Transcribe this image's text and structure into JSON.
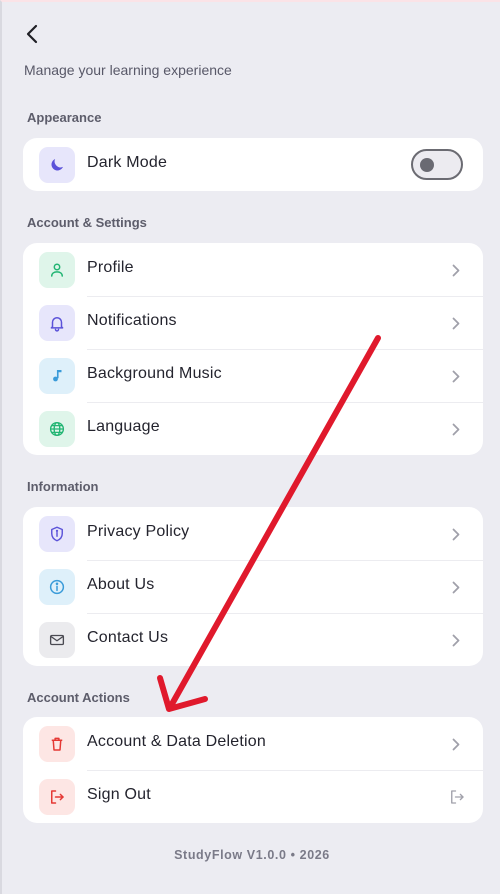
{
  "header": {
    "back_icon": "chevron-left-icon",
    "subtitle": "Manage your learning experience"
  },
  "sections": {
    "appearance": {
      "label": "Appearance",
      "dark_mode": {
        "label": "Dark Mode",
        "icon": "moon-icon",
        "enabled": false
      }
    },
    "account_settings": {
      "label": "Account & Settings",
      "items": [
        {
          "label": "Profile",
          "icon": "person-icon"
        },
        {
          "label": "Notifications",
          "icon": "bell-icon"
        },
        {
          "label": "Background Music",
          "icon": "music-note-icon"
        },
        {
          "label": "Language",
          "icon": "globe-icon"
        }
      ]
    },
    "information": {
      "label": "Information",
      "items": [
        {
          "label": "Privacy Policy",
          "icon": "shield-icon"
        },
        {
          "label": "About Us",
          "icon": "info-icon"
        },
        {
          "label": "Contact Us",
          "icon": "mail-icon"
        }
      ]
    },
    "account_actions": {
      "label": "Account Actions",
      "items": [
        {
          "label": "Account & Data Deletion",
          "icon": "trash-icon"
        },
        {
          "label": "Sign Out",
          "icon": "logout-icon"
        }
      ]
    }
  },
  "footer": {
    "version": "StudyFlow V1.0.0 • 2026"
  },
  "colors": {
    "background": "#ececf2",
    "card": "#ffffff",
    "annotation_arrow": "#e0192c",
    "purple_icon": "#5b52d9",
    "green_icon": "#22b573",
    "blue_icon": "#3a9bd9",
    "red_icon": "#e53935"
  }
}
